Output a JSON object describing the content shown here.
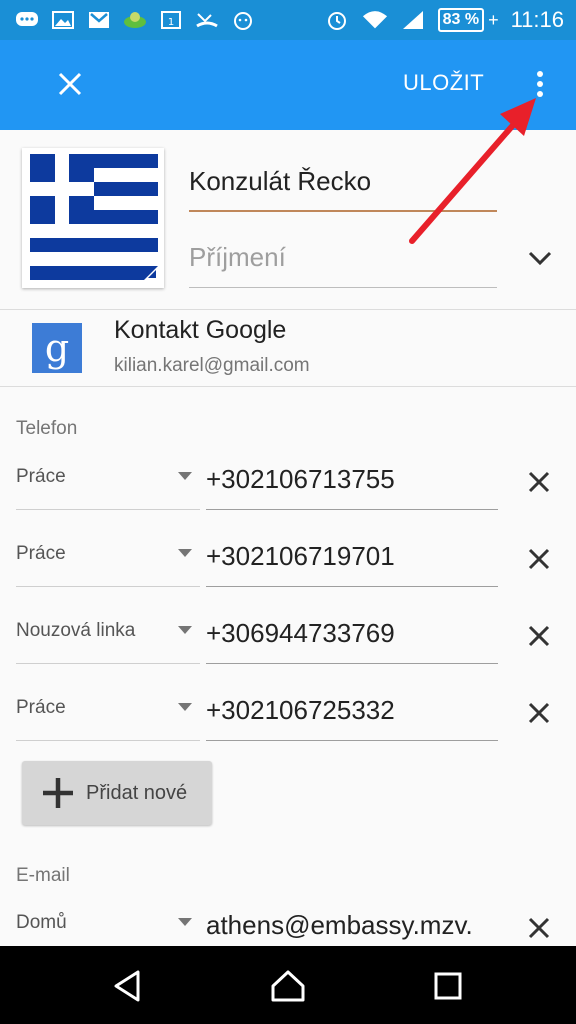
{
  "status_bar": {
    "battery": "83 %",
    "time": "11:16"
  },
  "toolbar": {
    "save_label": "ULOŽIT"
  },
  "contact": {
    "name": "Konzulát Řecko",
    "surname_placeholder": "Příjmení"
  },
  "account": {
    "title": "Kontakt Google",
    "email": "kilian.karel@gmail.com",
    "icon_letter": "g"
  },
  "phone_section": {
    "label": "Telefon",
    "entries": [
      {
        "type": "Práce",
        "number": "+302106713755"
      },
      {
        "type": "Práce",
        "number": "+302106719701"
      },
      {
        "type": "Nouzová linka",
        "number": "+306944733769"
      },
      {
        "type": "Práce",
        "number": "+302106725332"
      }
    ],
    "add_label": "Přidat nové"
  },
  "email_section": {
    "label": "E-mail",
    "entries": [
      {
        "type": "Domů",
        "address": "athens@embassy.mzv."
      }
    ]
  },
  "colors": {
    "status_bar": "#1a8fd6",
    "toolbar": "#2196f3",
    "name_underline": "#c0875a",
    "annotation_arrow": "#e8202a",
    "flag_blue": "#0d3a9e"
  },
  "icons": {
    "close": "close-icon",
    "more": "more-vert-icon",
    "expand": "chevron-down-icon",
    "remove": "close-icon",
    "add": "plus-icon",
    "nav_back": "back-triangle-icon",
    "nav_home": "home-icon",
    "nav_recents": "recents-square-icon"
  }
}
